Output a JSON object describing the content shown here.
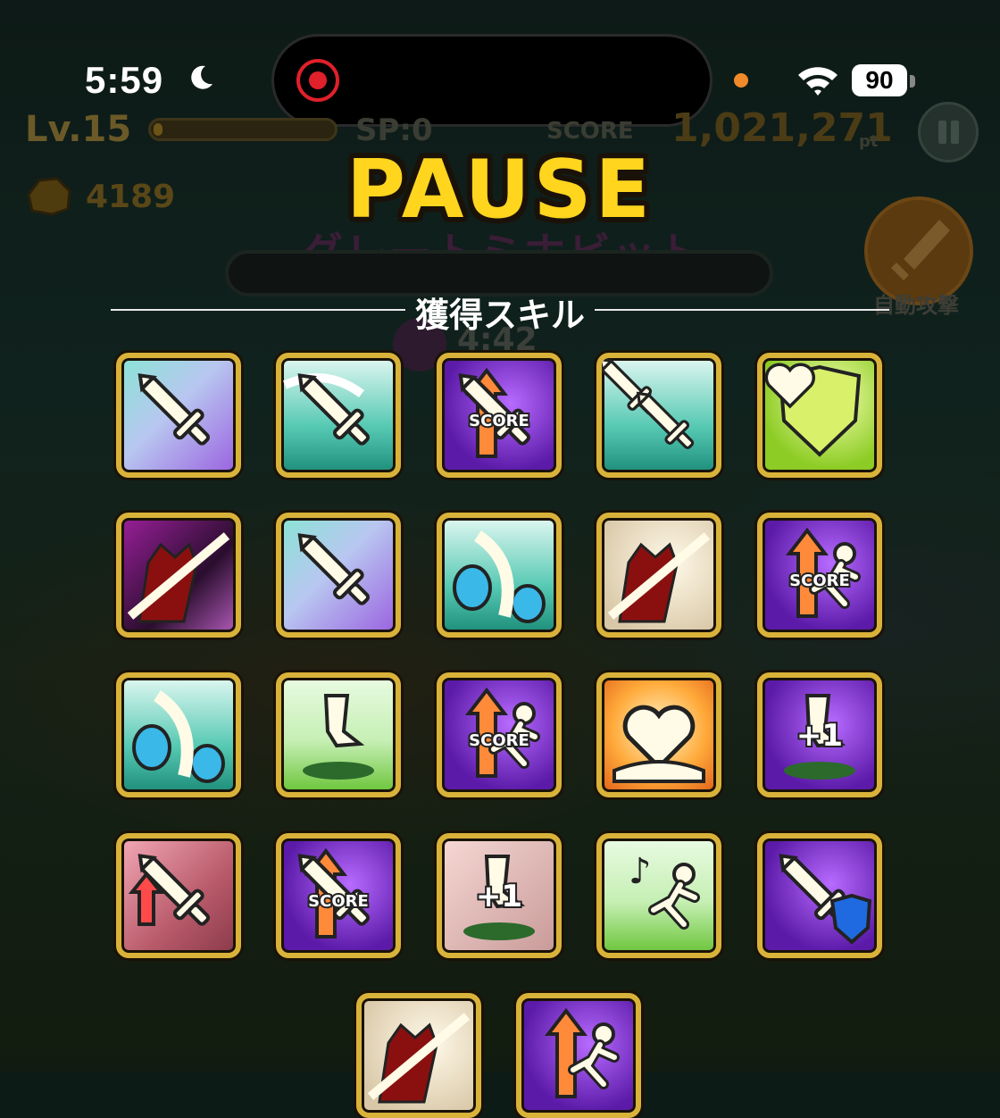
{
  "status_bar": {
    "time": "5:59",
    "battery": "90"
  },
  "hud": {
    "level": "Lv.15",
    "xp_progress": 0.03,
    "sp": "SP:0",
    "score_label": "SCORE",
    "score": "1,021,271",
    "score_unit": "pt",
    "gold": "4189",
    "stage_name": "グレートミホビット",
    "timer": "4:42",
    "auto_attack_label": "自動攻撃"
  },
  "pause_title": "PAUSE",
  "skills_section_title": "獲得スキル",
  "skills": [
    {
      "icon": "sword-power-icon",
      "theme": "lavender"
    },
    {
      "icon": "sword-dash-icon",
      "theme": "teal"
    },
    {
      "icon": "score-up-sword-icon",
      "theme": "purple",
      "badge": "SCORE"
    },
    {
      "icon": "double-sword-icon",
      "theme": "teal"
    },
    {
      "icon": "heart-shield-heal-icon",
      "theme": "lime"
    },
    {
      "icon": "demon-slash-icon",
      "theme": "dark"
    },
    {
      "icon": "sword-power-icon",
      "theme": "lavender"
    },
    {
      "icon": "strawberry-slash-icon",
      "theme": "teal"
    },
    {
      "icon": "demon-slash-icon",
      "theme": "cream"
    },
    {
      "icon": "score-up-runner-icon",
      "theme": "purple",
      "badge": "SCORE"
    },
    {
      "icon": "strawberry-slash-icon",
      "theme": "teal"
    },
    {
      "icon": "stomp-icon",
      "theme": "grass"
    },
    {
      "icon": "score-up-runner-icon",
      "theme": "purple",
      "badge": "SCORE"
    },
    {
      "icon": "heart-hand-icon",
      "theme": "orange"
    },
    {
      "icon": "stomp-plus-one-heart-icon",
      "theme": "purple",
      "badge": "+1"
    },
    {
      "icon": "sword-double-arrow-icon",
      "theme": "rose"
    },
    {
      "icon": "score-up-sword-icon",
      "theme": "purple",
      "badge": "SCORE"
    },
    {
      "icon": "stomp-plus-one-icon",
      "theme": "rosepale",
      "badge": "+1"
    },
    {
      "icon": "music-runner-icon",
      "theme": "grass"
    },
    {
      "icon": "sword-shield-heart-icon",
      "theme": "purple"
    },
    {
      "icon": "demon-slash-icon",
      "theme": "cream"
    },
    {
      "icon": "score-up-runner-icon",
      "theme": "purple"
    }
  ]
}
